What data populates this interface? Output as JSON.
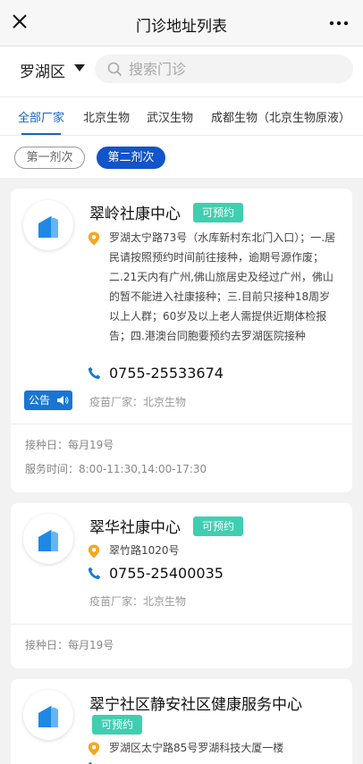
{
  "header": {
    "title": "门诊地址列表",
    "close_icon": "close-icon",
    "more_icon": "more-dots-icon"
  },
  "search": {
    "region": "罗湖区",
    "placeholder": "搜索门诊"
  },
  "tabs": [
    {
      "label": "全部厂家",
      "active": true
    },
    {
      "label": "北京生物",
      "active": false
    },
    {
      "label": "武汉生物",
      "active": false
    },
    {
      "label": "成都生物（北京生物原液）",
      "active": false
    }
  ],
  "doses": {
    "first": "第一剂次",
    "second": "第二剂次",
    "selected": "第二剂次"
  },
  "colors": {
    "accent": "#1254c9",
    "badge": "#3fcfb0",
    "pin": "#f5a623",
    "phone": "#1976d2"
  },
  "clinics": [
    {
      "name": "翠岭社康中心",
      "badge": "可预约",
      "address": "罗湖太宁路73号（水库新村东北门入口）；一.居民请按照预约时间前往接种，逾期号源作废；二.21天内有广州,佛山旅居史及经过广州，佛山的暂不能进入社康接种；三.目前只接种18周岁以上人群；60岁及以上老人需提供近期体检报告；四.港澳台同胞要预约去罗湖医院接种",
      "phone": "0755-25533674",
      "notice": "公告",
      "maker": "疫苗厂家：北京生物",
      "schedule": "接种日：每月19号",
      "hours": "服务时间：8:00-11:30,14:00-17:30"
    },
    {
      "name": "翠华社康中心",
      "badge": "可预约",
      "address": "翠竹路1020号",
      "phone": "0755-25400035",
      "maker": "疫苗厂家：北京生物",
      "schedule": "接种日：每月19号"
    },
    {
      "name": "翠宁社区静安社区健康服务中心",
      "badge": "可预约",
      "address": "罗湖区太宁路85号罗湖科技大厦一楼"
    }
  ]
}
